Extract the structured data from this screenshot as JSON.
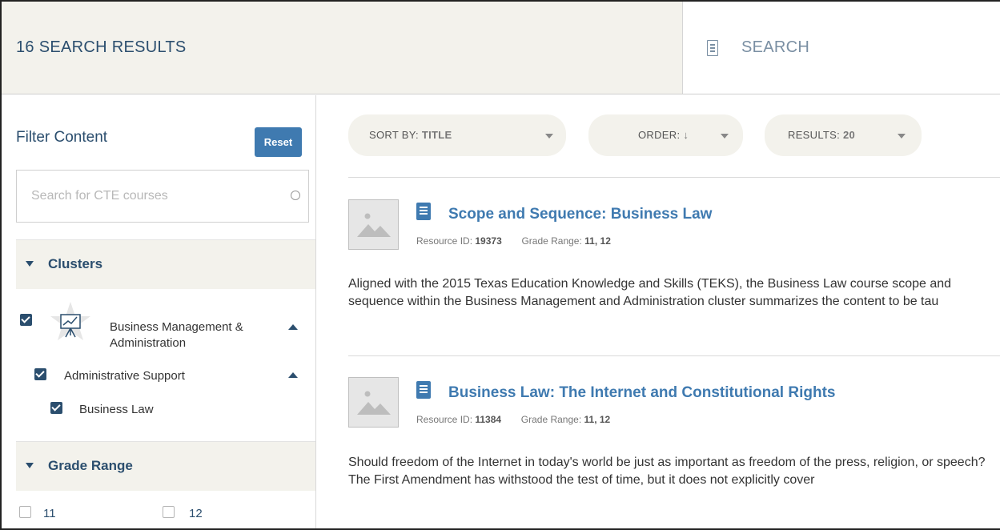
{
  "header": {
    "results_count": "16 SEARCH RESULTS",
    "search_label": "SEARCH"
  },
  "sidebar": {
    "filter_title": "Filter Content",
    "reset_label": "Reset",
    "search_placeholder": "Search for CTE courses",
    "clusters_label": "Clusters",
    "cluster_items": [
      {
        "label": "Business Management &",
        "label2": "Administration",
        "checked": true
      },
      {
        "label": "Administrative Support",
        "checked": true
      },
      {
        "label": "Business Law",
        "checked": true
      }
    ],
    "grade_range_label": "Grade Range",
    "grade_options": [
      {
        "label": "11",
        "checked": false
      },
      {
        "label": "12",
        "checked": false
      }
    ]
  },
  "controls": {
    "sort_label": "SORT BY:",
    "sort_value": "TITLE",
    "order_label": "ORDER:",
    "order_value": "↓",
    "results_label": "RESULTS:",
    "results_value": "20"
  },
  "results": [
    {
      "title": "Scope and Sequence: Business Law",
      "resource_id_label": "Resource ID:",
      "resource_id": "19373",
      "grade_label": "Grade Range:",
      "grade": "11, 12",
      "description": "Aligned with the 2015 Texas Education Knowledge and Skills (TEKS), the Business Law course scope and sequence within the Business Management and Administration cluster summarizes the content to be tau"
    },
    {
      "title": "Business Law: The Internet and Constitutional Rights",
      "resource_id_label": "Resource ID:",
      "resource_id": "11384",
      "grade_label": "Grade Range:",
      "grade": "11, 12",
      "description": "Should freedom of the Internet in today's world be just as important as freedom of the press, religion, or speech? The First Amendment has withstood the test of time, but it does not explicitly cover"
    }
  ],
  "colors": {
    "accent": "#3f7ab0",
    "navy": "#2b4e6e",
    "panel": "#f3f2ec"
  }
}
